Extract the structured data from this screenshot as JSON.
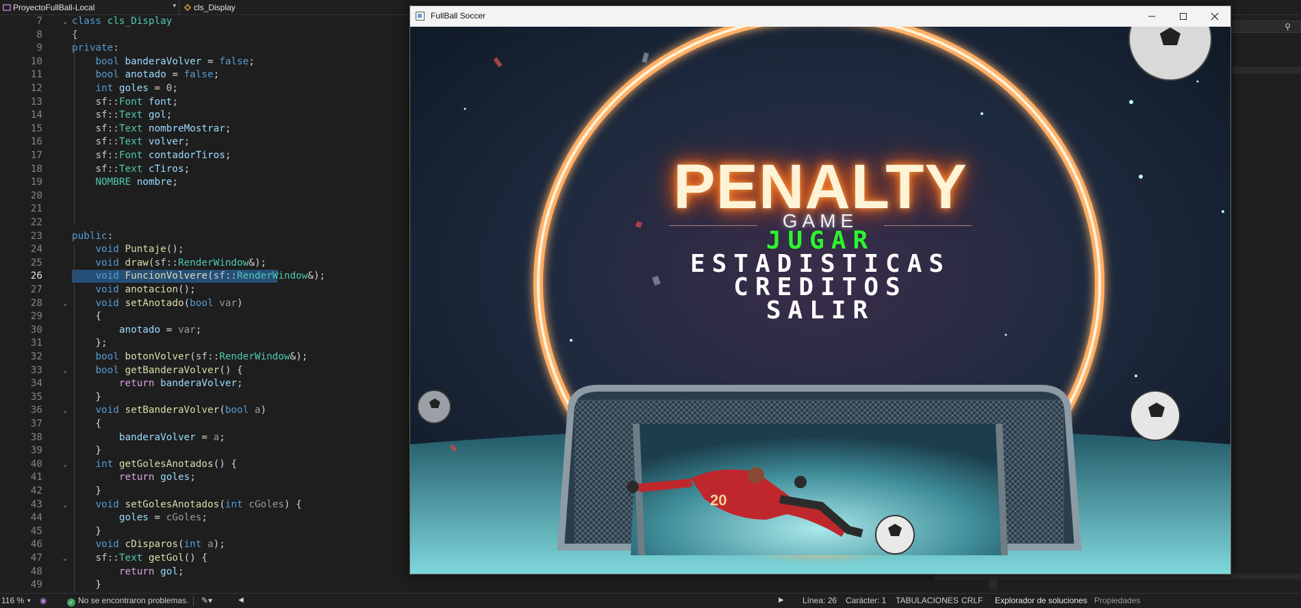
{
  "ide": {
    "project_combo": "ProyectoFullBall-Local",
    "class_combo": "cls_Display",
    "code_lines": [
      {
        "n": "7",
        "fold": true,
        "tokens": [
          [
            "kw",
            "class "
          ],
          [
            "ty",
            "cls_Display"
          ]
        ]
      },
      {
        "n": "8",
        "tokens": [
          [
            "",
            "{"
          ]
        ]
      },
      {
        "n": "9",
        "tokens": [
          [
            "kw",
            "private"
          ],
          [
            "",
            ":"
          ]
        ]
      },
      {
        "n": "10",
        "tokens": [
          [
            "",
            "    "
          ],
          [
            "kw",
            "bool "
          ],
          [
            "var",
            "banderaVolver"
          ],
          [
            "",
            " = "
          ],
          [
            "kw",
            "false"
          ],
          [
            "",
            ";"
          ]
        ]
      },
      {
        "n": "11",
        "tokens": [
          [
            "",
            "    "
          ],
          [
            "kw",
            "bool "
          ],
          [
            "var",
            "anotado"
          ],
          [
            "",
            " = "
          ],
          [
            "kw",
            "false"
          ],
          [
            "",
            ";"
          ]
        ]
      },
      {
        "n": "12",
        "tokens": [
          [
            "",
            "    "
          ],
          [
            "kw",
            "int "
          ],
          [
            "var",
            "goles"
          ],
          [
            "",
            " = "
          ],
          [
            "num",
            "0"
          ],
          [
            "",
            ";"
          ]
        ]
      },
      {
        "n": "13",
        "tokens": [
          [
            "",
            "    "
          ],
          [
            "ns",
            "sf::"
          ],
          [
            "ty",
            "Font "
          ],
          [
            "var",
            "font"
          ],
          [
            "",
            ";"
          ]
        ]
      },
      {
        "n": "14",
        "tokens": [
          [
            "",
            "    "
          ],
          [
            "ns",
            "sf::"
          ],
          [
            "ty",
            "Text "
          ],
          [
            "var",
            "gol"
          ],
          [
            "",
            ";"
          ]
        ]
      },
      {
        "n": "15",
        "tokens": [
          [
            "",
            "    "
          ],
          [
            "ns",
            "sf::"
          ],
          [
            "ty",
            "Text "
          ],
          [
            "var",
            "nombreMostrar"
          ],
          [
            "",
            ";"
          ]
        ]
      },
      {
        "n": "16",
        "tokens": [
          [
            "",
            "    "
          ],
          [
            "ns",
            "sf::"
          ],
          [
            "ty",
            "Text "
          ],
          [
            "var",
            "volver"
          ],
          [
            "",
            ";"
          ]
        ]
      },
      {
        "n": "17",
        "tokens": [
          [
            "",
            "    "
          ],
          [
            "ns",
            "sf::"
          ],
          [
            "ty",
            "Font "
          ],
          [
            "var",
            "contadorTiros"
          ],
          [
            "",
            ";"
          ]
        ]
      },
      {
        "n": "18",
        "tokens": [
          [
            "",
            "    "
          ],
          [
            "ns",
            "sf::"
          ],
          [
            "ty",
            "Text "
          ],
          [
            "var",
            "cTiros"
          ],
          [
            "",
            ";"
          ]
        ]
      },
      {
        "n": "19",
        "tokens": [
          [
            "",
            "    "
          ],
          [
            "ty",
            "NOMBRE "
          ],
          [
            "var",
            "nombre"
          ],
          [
            "",
            ";"
          ]
        ]
      },
      {
        "n": "20",
        "tokens": []
      },
      {
        "n": "21",
        "tokens": []
      },
      {
        "n": "22",
        "tokens": []
      },
      {
        "n": "23",
        "tokens": [
          [
            "kw",
            "public"
          ],
          [
            "",
            ":"
          ]
        ]
      },
      {
        "n": "24",
        "tokens": [
          [
            "",
            "    "
          ],
          [
            "kw",
            "void "
          ],
          [
            "fn",
            "Puntaje"
          ],
          [
            "",
            "();"
          ]
        ]
      },
      {
        "n": "25",
        "tokens": [
          [
            "",
            "    "
          ],
          [
            "kw",
            "void "
          ],
          [
            "fn",
            "draw"
          ],
          [
            "",
            "("
          ],
          [
            "ns",
            "sf::"
          ],
          [
            "ty",
            "RenderWindow"
          ],
          [
            "",
            "&);"
          ]
        ]
      },
      {
        "n": "26",
        "current": true,
        "tokens": [
          [
            "",
            "    "
          ],
          [
            "kw",
            "void "
          ],
          [
            "fn",
            "FuncionVolvere"
          ],
          [
            "",
            "("
          ],
          [
            "ns",
            "sf::"
          ],
          [
            "ty",
            "RenderWindow"
          ],
          [
            "",
            "&);"
          ]
        ]
      },
      {
        "n": "27",
        "tokens": [
          [
            "",
            "    "
          ],
          [
            "kw",
            "void "
          ],
          [
            "fn",
            "anotacion"
          ],
          [
            "",
            "();"
          ]
        ]
      },
      {
        "n": "28",
        "fold": true,
        "tokens": [
          [
            "",
            "    "
          ],
          [
            "kw",
            "void "
          ],
          [
            "fn",
            "setAnotado"
          ],
          [
            "",
            "("
          ],
          [
            "kw",
            "bool "
          ],
          [
            "prm",
            "var"
          ],
          [
            "",
            ")"
          ]
        ]
      },
      {
        "n": "29",
        "tokens": [
          [
            "",
            "    {"
          ]
        ]
      },
      {
        "n": "30",
        "tokens": [
          [
            "",
            "        "
          ],
          [
            "var",
            "anotado"
          ],
          [
            "",
            " = "
          ],
          [
            "prm",
            "var"
          ],
          [
            "",
            ";"
          ]
        ]
      },
      {
        "n": "31",
        "tokens": [
          [
            "",
            "    };"
          ]
        ]
      },
      {
        "n": "32",
        "tokens": [
          [
            "",
            "    "
          ],
          [
            "kw",
            "bool "
          ],
          [
            "fn",
            "botonVolver"
          ],
          [
            "",
            "("
          ],
          [
            "ns",
            "sf::"
          ],
          [
            "ty",
            "RenderWindow"
          ],
          [
            "",
            "&);"
          ]
        ]
      },
      {
        "n": "33",
        "fold": true,
        "tokens": [
          [
            "",
            "    "
          ],
          [
            "kw",
            "bool "
          ],
          [
            "fn",
            "getBanderaVolver"
          ],
          [
            "",
            "() {"
          ]
        ]
      },
      {
        "n": "34",
        "tokens": [
          [
            "",
            "        "
          ],
          [
            "ctl",
            "return "
          ],
          [
            "var",
            "banderaVolver"
          ],
          [
            "",
            ";"
          ]
        ]
      },
      {
        "n": "35",
        "tokens": [
          [
            "",
            "    }"
          ]
        ]
      },
      {
        "n": "36",
        "fold": true,
        "tokens": [
          [
            "",
            "    "
          ],
          [
            "kw",
            "void "
          ],
          [
            "fn",
            "setBanderaVolver"
          ],
          [
            "",
            "("
          ],
          [
            "kw",
            "bool "
          ],
          [
            "prm",
            "a"
          ],
          [
            "",
            ")"
          ]
        ]
      },
      {
        "n": "37",
        "tokens": [
          [
            "",
            "    {"
          ]
        ]
      },
      {
        "n": "38",
        "tokens": [
          [
            "",
            "        "
          ],
          [
            "var",
            "banderaVolver"
          ],
          [
            "",
            " = "
          ],
          [
            "prm",
            "a"
          ],
          [
            "",
            ";"
          ]
        ]
      },
      {
        "n": "39",
        "tokens": [
          [
            "",
            "    }"
          ]
        ]
      },
      {
        "n": "40",
        "fold": true,
        "tokens": [
          [
            "",
            "    "
          ],
          [
            "kw",
            "int "
          ],
          [
            "fn",
            "getGolesAnotados"
          ],
          [
            "",
            "() {"
          ]
        ]
      },
      {
        "n": "41",
        "tokens": [
          [
            "",
            "        "
          ],
          [
            "ctl",
            "return "
          ],
          [
            "var",
            "goles"
          ],
          [
            "",
            ";"
          ]
        ]
      },
      {
        "n": "42",
        "tokens": [
          [
            "",
            "    }"
          ]
        ]
      },
      {
        "n": "43",
        "fold": true,
        "tokens": [
          [
            "",
            "    "
          ],
          [
            "kw",
            "void "
          ],
          [
            "fn",
            "setGolesAnotados"
          ],
          [
            "",
            "("
          ],
          [
            "kw",
            "int "
          ],
          [
            "prm",
            "cGoles"
          ],
          [
            "",
            ") {"
          ]
        ]
      },
      {
        "n": "44",
        "tokens": [
          [
            "",
            "        "
          ],
          [
            "var",
            "goles"
          ],
          [
            "",
            " = "
          ],
          [
            "prm",
            "cGoles"
          ],
          [
            "",
            ";"
          ]
        ]
      },
      {
        "n": "45",
        "tokens": [
          [
            "",
            "    }"
          ]
        ]
      },
      {
        "n": "46",
        "tokens": [
          [
            "",
            "    "
          ],
          [
            "kw",
            "void "
          ],
          [
            "fn",
            "cDisparos"
          ],
          [
            "",
            "("
          ],
          [
            "kw",
            "int "
          ],
          [
            "prm",
            "a"
          ],
          [
            "",
            ");"
          ]
        ]
      },
      {
        "n": "47",
        "fold": true,
        "tokens": [
          [
            "",
            "    "
          ],
          [
            "ns",
            "sf::"
          ],
          [
            "ty",
            "Text "
          ],
          [
            "fn",
            "getGol"
          ],
          [
            "",
            "() {"
          ]
        ]
      },
      {
        "n": "48",
        "tokens": [
          [
            "",
            "        "
          ],
          [
            "ctl",
            "return "
          ],
          [
            "var",
            "gol"
          ],
          [
            "",
            ";"
          ]
        ]
      },
      {
        "n": "49",
        "tokens": [
          [
            "",
            "    }"
          ]
        ]
      }
    ]
  },
  "status": {
    "zoom": "116 %",
    "problems": "No se encontraron problemas.",
    "line": "Línea: 26",
    "char": "Carácter: 1",
    "indent": "TABULACIONES",
    "eol": "CRLF",
    "solution_tab": "Explorador de soluciones",
    "props_tab": "Propiedades"
  },
  "game": {
    "window_title": "FullBall Soccer",
    "logo_title": "PENALTY",
    "logo_subtitle": "GAME",
    "menu": [
      "JUGAR",
      "ESTADISTICAS",
      "CREDITOS",
      "SALIR"
    ],
    "selected_menu_index": 0,
    "player_number": "20",
    "colors": {
      "selected": "#2cf52c",
      "ring": "#ff8a3d",
      "menu_text": "#ffffff"
    }
  }
}
